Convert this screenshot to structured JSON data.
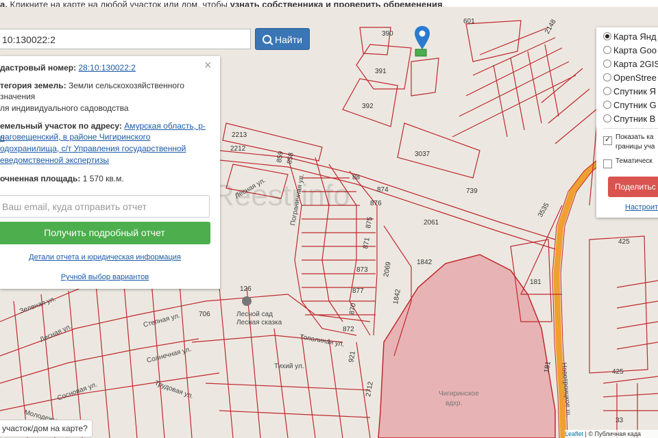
{
  "topbar": {
    "prefix": "а.",
    "text": "Кликните на карте на любой участок или дом, чтобы",
    "bold": "узнать собственника и проверить обременения",
    "suffix": "."
  },
  "search": {
    "value": "10:130022:2",
    "button_label": "Найти"
  },
  "info": {
    "cadastral_label": "дастровый номер:",
    "cadastral_value": "28:10:130022:2",
    "category_label": "тегория земель:",
    "category_value_1": "Земли сельскохозяйственного",
    "category_value_2": "значения",
    "usage": "ля индивидуального садоводства",
    "address_label": "емельный участок по адресу:",
    "address_1": "Амурская область, р-н",
    "address_2": "лаговещенский, в районе Чигиринского",
    "address_3": "одохранилища, с/т Управления государственной",
    "address_4": "еведомственной экспертизы",
    "area_label": "очненная площадь:",
    "area_value": "1 570 кв.м.",
    "email_placeholder": "Ваш email, куда отправить отчет",
    "get_report": "Получить подробный отчет",
    "details_link": "Детали отчета и юридическая информация",
    "manual_link": "Ручной выбор вариантов"
  },
  "layers": {
    "items": [
      {
        "label": "Карта Янд",
        "selected": true
      },
      {
        "label": "Карта Goo",
        "selected": false
      },
      {
        "label": "Карта 2GIS",
        "selected": false
      },
      {
        "label": "OpenStree",
        "selected": false
      },
      {
        "label": "Спутник Я",
        "selected": false
      },
      {
        "label": "Спутник G",
        "selected": false
      },
      {
        "label": "Спутник В",
        "selected": false
      }
    ],
    "show_label_1": "Показать ка",
    "show_label_2": "границы уча",
    "thematic": "Тематическ",
    "share": "Поделитьс",
    "setup": "Настроит"
  },
  "bottom_question": "участок/дом на карте?",
  "attribution": {
    "leaflet": "Leaflet",
    "rest": "| © Публичная када"
  },
  "map_labels": {
    "parcels": [
      "390",
      "391",
      "392",
      "601",
      "2148",
      "3037",
      "739",
      "3535",
      "2213",
      "2212",
      "859",
      "858",
      "88",
      "874",
      "876",
      "875",
      "871",
      "873",
      "877",
      "870",
      "872",
      "2069",
      "1842",
      "1842",
      "2061",
      "181",
      "425",
      "425",
      "181",
      "706",
      "126",
      "2712",
      "921",
      "33"
    ],
    "streets": [
      "Зеленая ул.",
      "Степная ул.",
      "Лесная ул.",
      "Солнечная ул.",
      "Сосновая ул.",
      "Молодежная ул.",
      "Трудовая ул.",
      "Тихий ул.",
      "Тополиная ул.",
      "Пограничная ул.",
      "Новотроицкое ш.",
      "Лесная ул."
    ],
    "place_1": "Лесной сад",
    "place_2": "Лесная сказка",
    "water_1": "Чигиринское",
    "water_2": "вдхр.",
    "watermark": "Reestrinfo"
  },
  "colors": {
    "parcel": "#c0282d",
    "water": "#e8b3b4",
    "button_blue": "#3a76b5",
    "button_green": "#4cae4c",
    "button_red": "#d9534f",
    "road": "#f0a030"
  }
}
